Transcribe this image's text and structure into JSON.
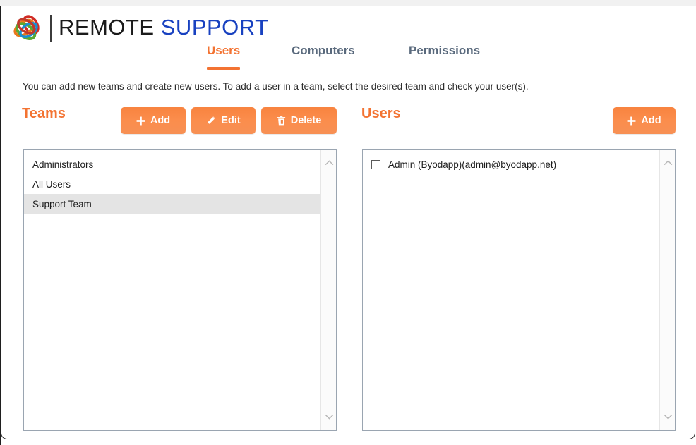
{
  "window": {
    "brand_primary": "REMOTE",
    "brand_secondary": "SUPPORT",
    "brand_primary_color": "#1b1b1b",
    "brand_secondary_color": "#1841c0",
    "accent_color": "#f37332"
  },
  "tabs": [
    {
      "label": "Users",
      "active": true
    },
    {
      "label": "Computers",
      "active": false
    },
    {
      "label": "Permissions",
      "active": false
    }
  ],
  "description": "You can add new teams and create new users. To add a user in a team, select the desired team and check your user(s).",
  "teams_panel": {
    "title": "Teams",
    "buttons": [
      {
        "label": "Add",
        "icon": "plus-icon"
      },
      {
        "label": "Edit",
        "icon": "pencil-icon"
      },
      {
        "label": "Delete",
        "icon": "trash-icon"
      }
    ],
    "items": [
      {
        "label": "Administrators",
        "selected": false
      },
      {
        "label": "All Users",
        "selected": false
      },
      {
        "label": "Support Team",
        "selected": true
      }
    ]
  },
  "users_panel": {
    "title": "Users",
    "buttons": [
      {
        "label": "Add",
        "icon": "plus-icon"
      }
    ],
    "items": [
      {
        "label": "Admin (Byodapp)(admin@byodapp.net)",
        "checked": false
      }
    ]
  }
}
